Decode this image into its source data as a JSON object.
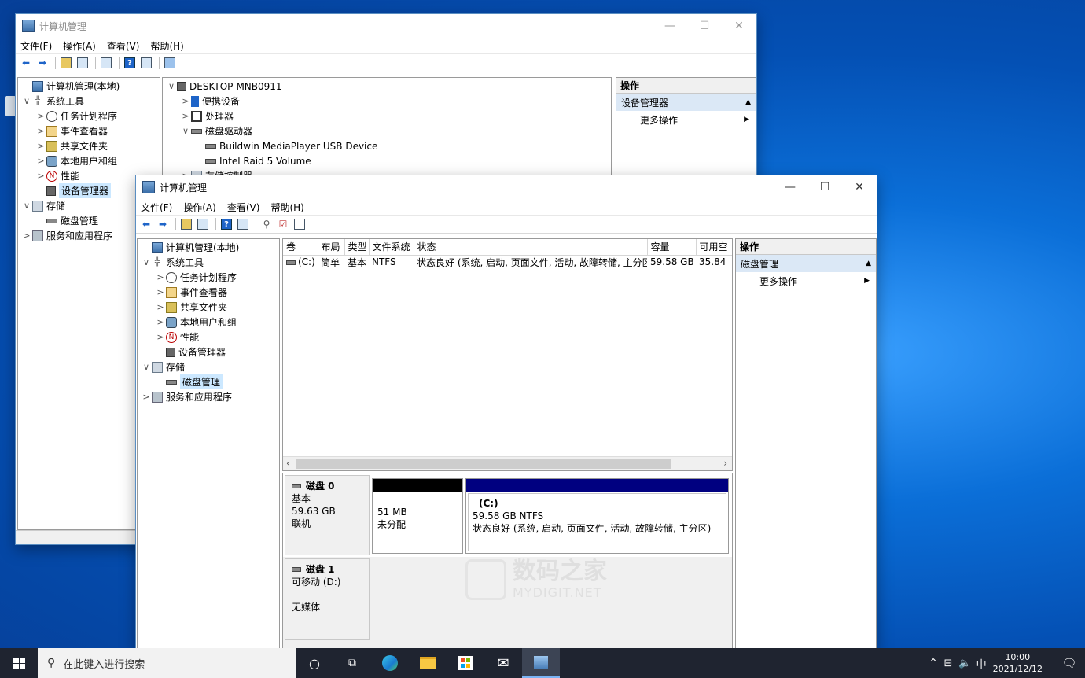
{
  "back_window": {
    "title": "计算机管理",
    "menu": [
      "文件(F)",
      "操作(A)",
      "查看(V)",
      "帮助(H)"
    ],
    "tree": [
      {
        "label": "计算机管理(本地)",
        "icon": "computer-icon",
        "level": 0,
        "chev": ""
      },
      {
        "label": "系统工具",
        "icon": "tools-icon",
        "level": 0,
        "chev": "∨"
      },
      {
        "label": "任务计划程序",
        "icon": "clock-icon",
        "level": 1,
        "chev": ">"
      },
      {
        "label": "事件查看器",
        "icon": "event-icon",
        "level": 1,
        "chev": ">"
      },
      {
        "label": "共享文件夹",
        "icon": "share-icon",
        "level": 1,
        "chev": ">"
      },
      {
        "label": "本地用户和组",
        "icon": "users-icon",
        "level": 1,
        "chev": ">"
      },
      {
        "label": "性能",
        "icon": "performance-icon",
        "level": 1,
        "chev": ">"
      },
      {
        "label": "设备管理器",
        "icon": "device-icon",
        "level": 1,
        "chev": "",
        "selected": true
      },
      {
        "label": "存储",
        "icon": "storage-icon",
        "level": 0,
        "chev": "∨"
      },
      {
        "label": "磁盘管理",
        "icon": "disk-icon",
        "level": 1,
        "chev": ""
      },
      {
        "label": "服务和应用程序",
        "icon": "services-icon",
        "level": 0,
        "chev": ">"
      }
    ],
    "devices": [
      {
        "label": "DESKTOP-MNB0911",
        "level": 0,
        "chev": "∨"
      },
      {
        "label": "便携设备",
        "level": 1,
        "chev": ">"
      },
      {
        "label": "处理器",
        "level": 1,
        "chev": ">"
      },
      {
        "label": "磁盘驱动器",
        "level": 1,
        "chev": "∨"
      },
      {
        "label": "Buildwin  MediaPlayer USB Device",
        "level": 2,
        "chev": ""
      },
      {
        "label": "Intel Raid 5 Volume",
        "level": 2,
        "chev": ""
      },
      {
        "label": "存储控制器",
        "level": 1,
        "chev": ">"
      }
    ],
    "actions": {
      "header": "操作",
      "section": "设备管理器",
      "item": "更多操作"
    }
  },
  "front_window": {
    "title": "计算机管理",
    "menu": [
      "文件(F)",
      "操作(A)",
      "查看(V)",
      "帮助(H)"
    ],
    "tree": [
      {
        "label": "计算机管理(本地)",
        "icon": "computer-icon",
        "level": 0,
        "chev": ""
      },
      {
        "label": "系统工具",
        "icon": "tools-icon",
        "level": 0,
        "chev": "∨"
      },
      {
        "label": "任务计划程序",
        "icon": "clock-icon",
        "level": 1,
        "chev": ">"
      },
      {
        "label": "事件查看器",
        "icon": "event-icon",
        "level": 1,
        "chev": ">"
      },
      {
        "label": "共享文件夹",
        "icon": "share-icon",
        "level": 1,
        "chev": ">"
      },
      {
        "label": "本地用户和组",
        "icon": "users-icon",
        "level": 1,
        "chev": ">"
      },
      {
        "label": "性能",
        "icon": "performance-icon",
        "level": 1,
        "chev": ">"
      },
      {
        "label": "设备管理器",
        "icon": "device-icon",
        "level": 1,
        "chev": ""
      },
      {
        "label": "存储",
        "icon": "storage-icon",
        "level": 0,
        "chev": "∨"
      },
      {
        "label": "磁盘管理",
        "icon": "disk-icon",
        "level": 1,
        "chev": "",
        "selected": true
      },
      {
        "label": "服务和应用程序",
        "icon": "services-icon",
        "level": 0,
        "chev": ">"
      }
    ],
    "volume_table": {
      "headers": [
        "卷",
        "布局",
        "类型",
        "文件系统",
        "状态",
        "容量",
        "可用空"
      ],
      "rows": [
        [
          "(C:)",
          "简单",
          "基本",
          "NTFS",
          "状态良好 (系统, 启动, 页面文件, 活动, 故障转储, 主分区)",
          "59.58 GB",
          "35.84"
        ]
      ]
    },
    "disks": [
      {
        "name": "磁盘 0",
        "type": "基本",
        "size": "59.63 GB",
        "status": "联机",
        "partitions": [
          {
            "size": "51 MB",
            "label": "未分配",
            "name": "",
            "color": "#000000"
          },
          {
            "name": "(C:)",
            "size": "59.58 GB NTFS",
            "label": "状态良好 (系统, 启动, 页面文件, 活动, 故障转储, 主分区)",
            "color": "#000080"
          }
        ]
      },
      {
        "name": "磁盘 1",
        "type": "可移动 (D:)",
        "size": "",
        "status": "无媒体",
        "partitions": []
      }
    ],
    "actions": {
      "header": "操作",
      "section": "磁盘管理",
      "item": "更多操作"
    }
  },
  "watermark": {
    "cn": "数码之家",
    "en": "MYDIGIT.NET"
  },
  "taskbar": {
    "search_placeholder": "在此键入进行搜索",
    "ime": "中",
    "time": "10:00",
    "date": "2021/12/12"
  }
}
